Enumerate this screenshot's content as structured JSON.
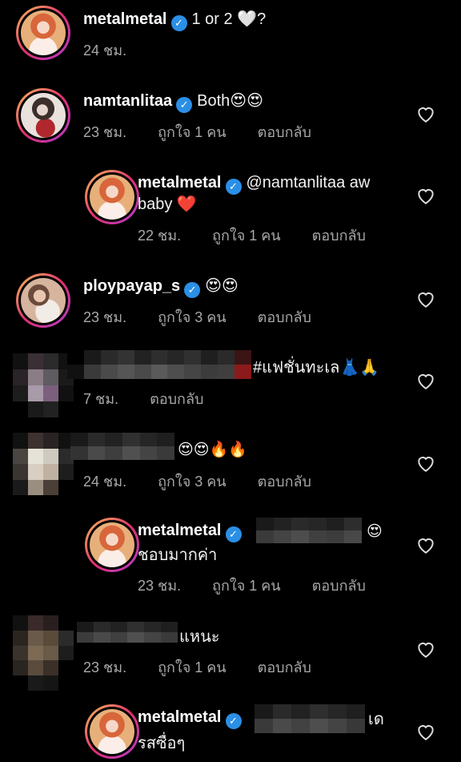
{
  "comments": [
    {
      "username": "metalmetal",
      "text": "1 or 2 🤍?",
      "time": "24 ชม."
    },
    {
      "username": "namtanlitaa",
      "text": "Both😍😍",
      "time": "23 ชม.",
      "likes": "ถูกใจ 1 คน",
      "reply": "ตอบกลับ"
    },
    {
      "username": "metalmetal",
      "text": "@namtanlitaa aw",
      "text2": "baby ❤️",
      "time": "22 ชม.",
      "likes": "ถูกใจ 1 คน",
      "reply": "ตอบกลับ"
    },
    {
      "username": "ploypayap_s",
      "text": "😍😍",
      "time": "23 ชม.",
      "likes": "ถูกใจ 3 คน",
      "reply": "ตอบกลับ"
    },
    {
      "text": "#แฟชั่นทะเล👗🙏",
      "time": "7 ชม.",
      "reply": "ตอบกลับ"
    },
    {
      "text": "😍😍🔥🔥",
      "time": "24 ชม.",
      "likes": "ถูกใจ 3 คน",
      "reply": "ตอบกลับ"
    },
    {
      "username": "metalmetal",
      "text": "😍",
      "text2": "ชอบมากค่า",
      "time": "23 ชม.",
      "likes": "ถูกใจ 1 คน",
      "reply": "ตอบกลับ"
    },
    {
      "text": "แหนะ",
      "time": "23 ชม.",
      "likes": "ถูกใจ 1 คน",
      "reply": "ตอบกลับ"
    },
    {
      "username": "metalmetal",
      "text": "เด",
      "text2": "รสซื่อๆ"
    }
  ],
  "icons": {
    "verified": "verified-badge-icon",
    "like": "heart-outline-icon"
  },
  "colors": {
    "background": "#000000",
    "verified": "#2b8fe6",
    "meta": "#a8a8a8"
  }
}
